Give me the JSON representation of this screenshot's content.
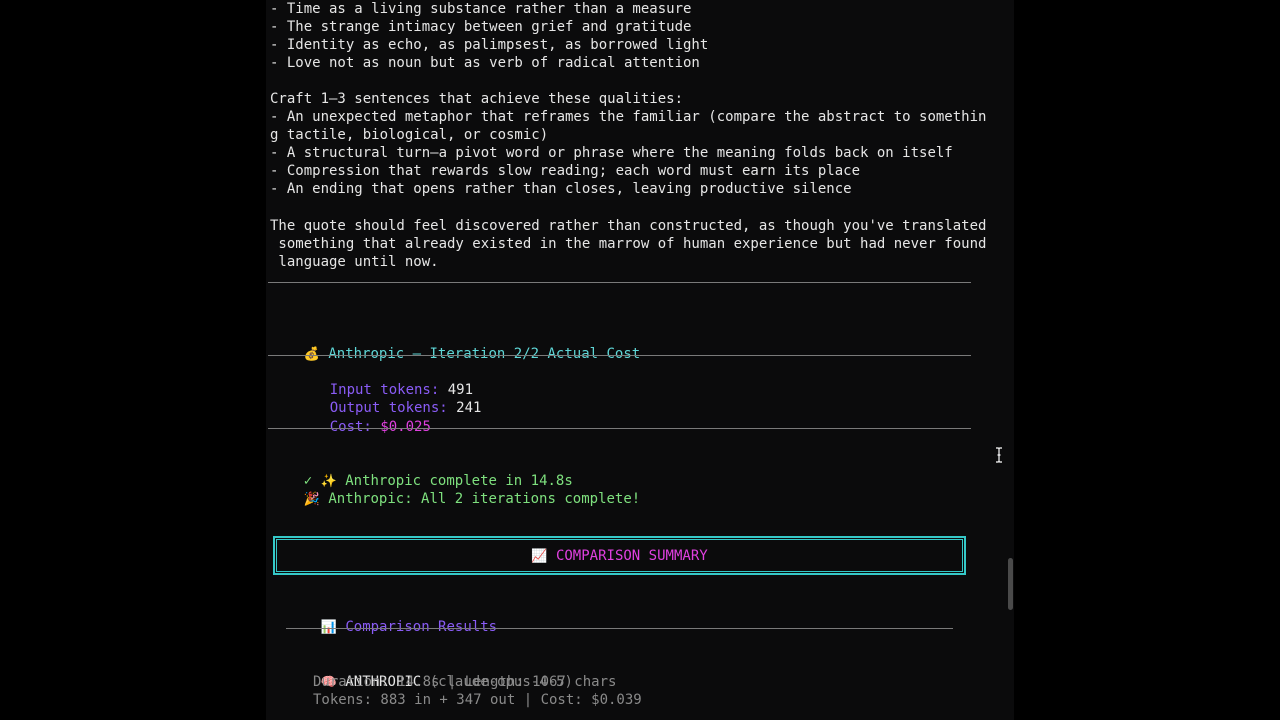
{
  "prompt_lines": [
    "- Time as a living substance rather than a measure",
    "- The strange intimacy between grief and gratitude",
    "- Identity as echo, as palimpsest, as borrowed light",
    "- Love not as noun but as verb of radical attention",
    "",
    "Craft 1–3 sentences that achieve these qualities:",
    "- An unexpected metaphor that reframes the familiar (compare the abstract to somethin",
    "g tactile, biological, or cosmic)",
    "- A structural turn—a pivot word or phrase where the meaning folds back on itself",
    "- Compression that rewards slow reading; each word must earn its place",
    "- An ending that opens rather than closes, leaving productive silence",
    "",
    "The quote should feel discovered rather than constructed, as though you've translated",
    " something that already existed in the marrow of human experience but had never found",
    " language until now."
  ],
  "cost_section": {
    "icon": "money-bag-icon",
    "title": "Anthropic – Iteration 2/2 Actual Cost",
    "input_label": "Input tokens:",
    "input_value": "491",
    "output_label": "Output tokens:",
    "output_value": "241",
    "cost_label": "Cost:",
    "cost_value": "$0.025"
  },
  "status": {
    "complete_check": "✓",
    "complete_text": "Anthropic complete in 14.8s",
    "all_done_text": "Anthropic: All 2 iterations complete!"
  },
  "summary": {
    "icon": "chart-increasing-icon",
    "title": "COMPARISON SUMMARY"
  },
  "results": {
    "icon": "bar-chart-icon",
    "title": "Comparison Results",
    "entries": [
      {
        "icon": "brain-icon",
        "provider": "ANTHROPIC",
        "model": "(claude-opus-4-5)",
        "duration_line": "Duration: 14.8s | Length: 1067 chars",
        "tokens_line": "Tokens: 883 in + 347 out | Cost: $0.039"
      }
    ]
  },
  "colors": {
    "cyan": "#5fd7d7",
    "purple": "#8a5cf6",
    "magenta": "#e040e0",
    "green": "#7ee07e",
    "box_border": "#35c8c8"
  }
}
